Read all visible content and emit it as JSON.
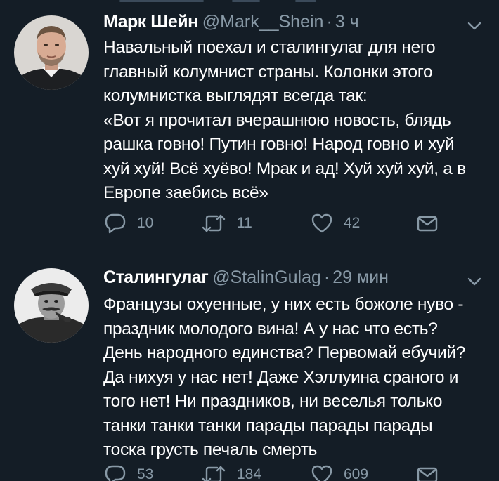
{
  "tweets": [
    {
      "display_name": "Марк Шейн",
      "handle": "@Mark__Shein",
      "separator": "·",
      "time": "3 ч",
      "text_lines": [
        "Навальный поехал и сталингулаг для него",
        "главный колумнист страны. Колонки этого",
        "колумнистка выглядят всегда так:",
        "«Вот я прочитал вчерашнюю новость, блядь",
        "рашка говно! Путин говно! Народ говно и хуй",
        "хуй хуй! Всё хуёво! Мрак и ад! Хуй хуй хуй, а в",
        "Европе заебись всё»"
      ],
      "replies": "10",
      "retweets": "11",
      "likes": "42",
      "icons": {
        "avatar": "bearded-man-portrait",
        "menu": "chevron-down-icon",
        "reply": "reply-icon",
        "retweet": "retweet-icon",
        "like": "heart-icon",
        "dm": "envelope-icon"
      }
    },
    {
      "display_name": "Сталингулаг",
      "handle": "@StalinGulag",
      "separator": "·",
      "time": "29 мин",
      "text_lines": [
        "Французы охуенные, у них есть божоле нуво -",
        "праздник молодого вина! А у нас что есть?",
        "День народного единства? Первомай ебучий?",
        "Да нихуя у нас нет! Даже Хэллуина сраного и",
        "того нет! Ни праздников, ни веселья только",
        "танки танки танки парады парады парады",
        "тоска грусть печаль смерть"
      ],
      "replies": "53",
      "retweets": "184",
      "likes": "609",
      "icons": {
        "avatar": "stalin-portrait-bw",
        "menu": "chevron-down-icon",
        "reply": "reply-icon",
        "retweet": "retweet-icon",
        "like": "heart-icon",
        "dm": "envelope-icon"
      }
    }
  ],
  "colors": {
    "background": "#141d26",
    "divider": "#38444d",
    "text_primary": "#ffffff",
    "text_secondary": "#8899a6"
  }
}
